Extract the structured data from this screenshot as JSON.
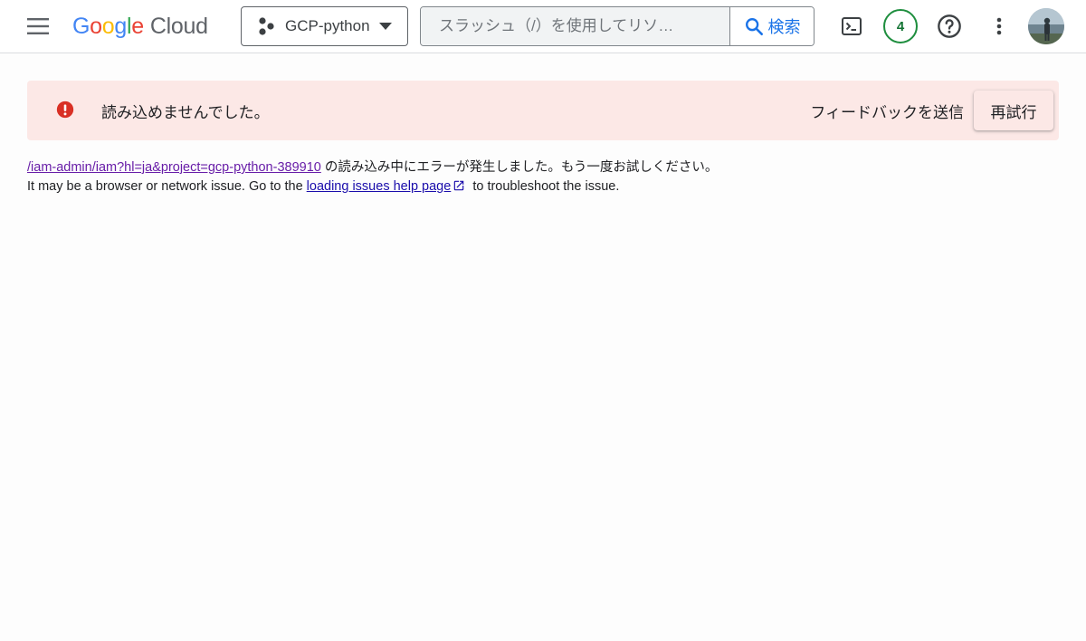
{
  "header": {
    "logo_text_google": "Google",
    "logo_text_cloud": "Cloud",
    "project_name": "GCP-python",
    "search": {
      "placeholder": "スラッシュ（/）を使用してリソ…",
      "button_label": "検索"
    },
    "notification_count": "4",
    "icons": [
      "menu-icon",
      "project-icon",
      "chevron-down-icon",
      "search-icon",
      "terminal-icon",
      "help-icon",
      "more-vert-icon"
    ]
  },
  "alert": {
    "message": "読み込めませんでした。",
    "feedback_label": "フィードバックを送信",
    "retry_label": "再試行",
    "colors": {
      "background": "#fce8e6",
      "icon": "#d93025"
    }
  },
  "details": {
    "url_link": "/iam-admin/iam?hl=ja&project=gcp-python-389910",
    "url_suffix": " の読み込み中にエラーが発生しました。もう一度お試しください。",
    "line2_prefix": "It may be a browser or network issue. Go to the ",
    "help_link": "loading issues help page",
    "line2_suffix": " to troubleshoot the issue."
  }
}
